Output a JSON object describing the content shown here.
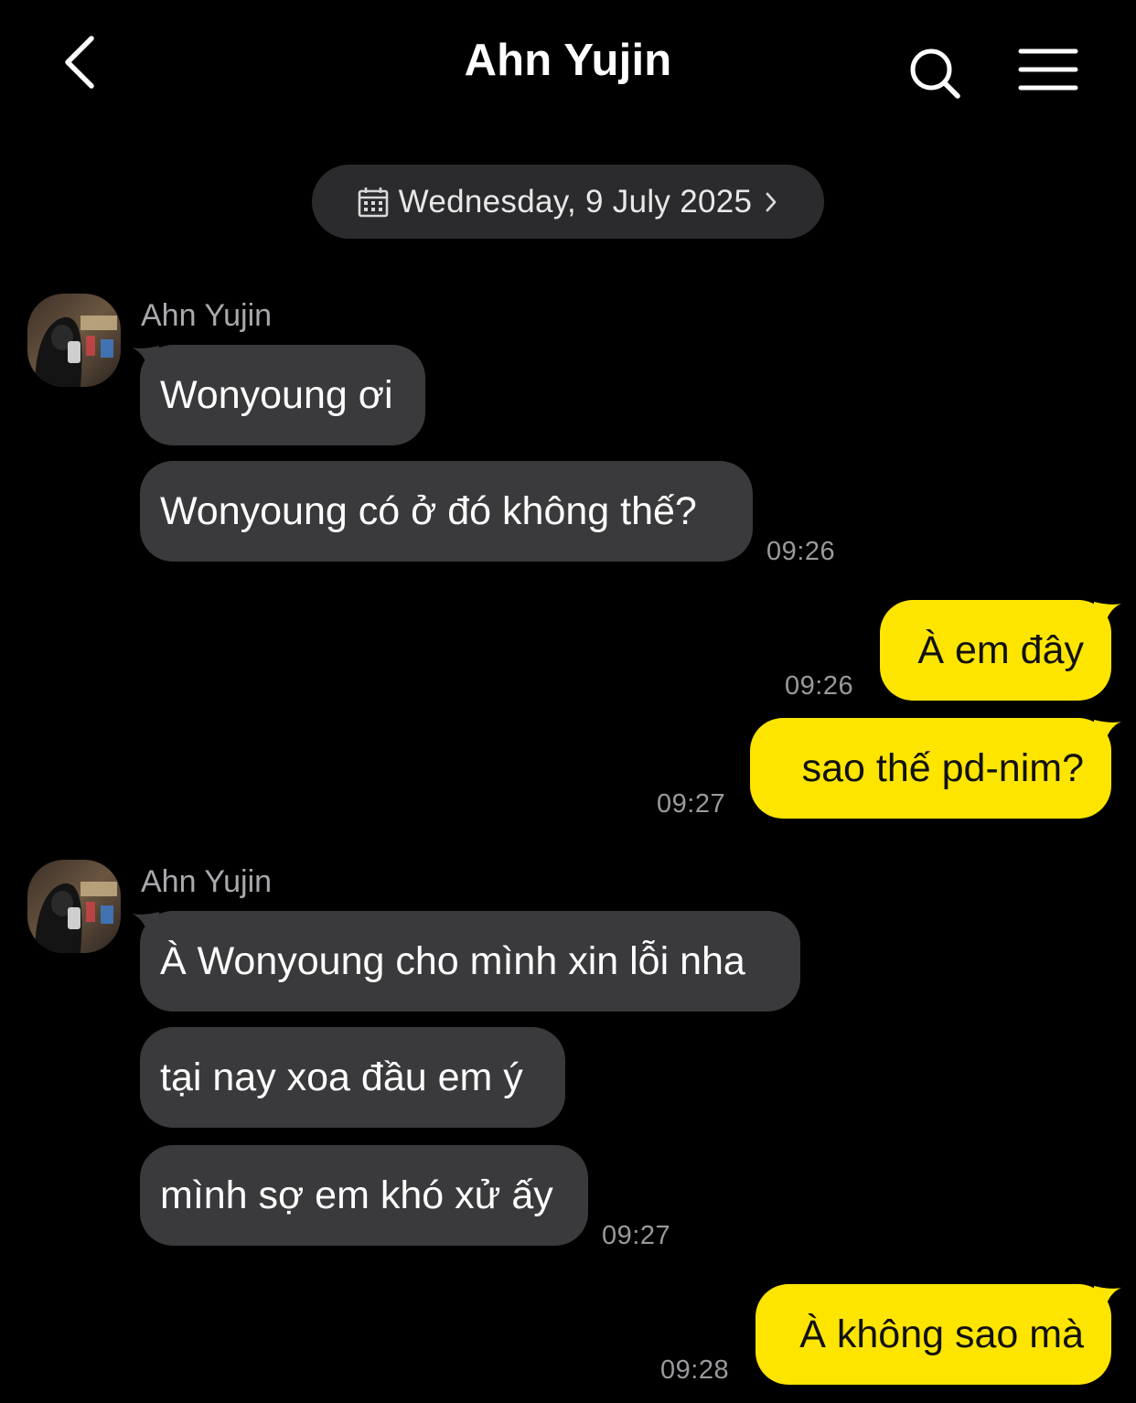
{
  "header": {
    "title": "Ahn Yujin",
    "back_icon": "chevron-left-icon",
    "search_icon": "search-icon",
    "menu_icon": "hamburger-menu-icon"
  },
  "date_divider": {
    "label": "Wednesday, 9 July 2025",
    "icon": "calendar-icon"
  },
  "colors": {
    "background": "#000000",
    "incoming_bubble": "#3a3a3c",
    "outgoing_bubble": "#fee500",
    "timestamp": "#9a9a9e"
  },
  "messages": {
    "group1": {
      "sender": "Ahn Yujin",
      "texts": [
        "Wonyoung ơi",
        "Wonyoung có ở đó không thế?"
      ],
      "time": "09:26"
    },
    "out1": {
      "text": "À em đây",
      "time": "09:26"
    },
    "out2": {
      "text": "sao thế pd-nim?",
      "time": "09:27"
    },
    "group2": {
      "sender": "Ahn Yujin",
      "texts": [
        "À Wonyoung cho mình xin lỗi nha",
        "tại nay xoa đầu em ý",
        "mình sợ em khó xử ấy"
      ],
      "time": "09:27"
    },
    "out3": {
      "text": "À không sao mà",
      "time": "09:28"
    }
  }
}
